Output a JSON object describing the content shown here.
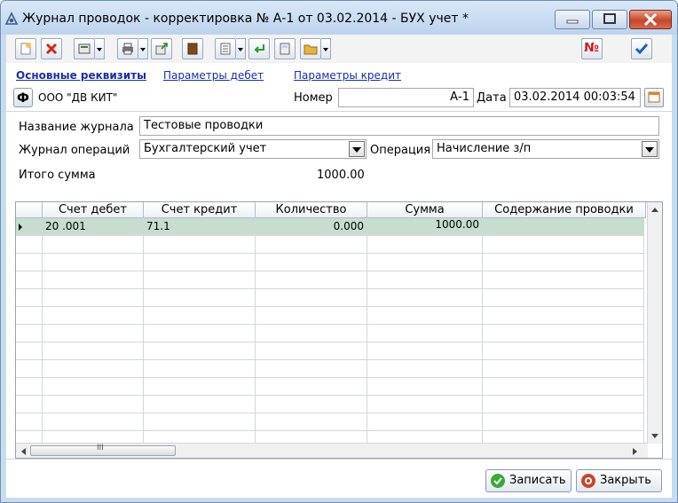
{
  "window": {
    "title": "Журнал проводок - корректировка № А-1 от 03.02.2014 - БУХ учет *"
  },
  "toolbar": {
    "number_icon_text": "№"
  },
  "tabs": [
    {
      "label": "Основные реквизиты",
      "active": true
    },
    {
      "label": "Параметры дебет",
      "active": false
    },
    {
      "label": "Параметры кредит",
      "active": false
    }
  ],
  "header": {
    "f_button": "Ф",
    "organization": "ООО \"ДВ КИТ\"",
    "number_label": "Номер",
    "number_value": "А-1",
    "date_label": "Дата",
    "date_value": "03.02.2014 00:03:54"
  },
  "form": {
    "journal_name_label": "Название журнала",
    "journal_name_value": "Тестовые проводки",
    "ops_journal_label": "Журнал операций",
    "ops_journal_value": "Бухгалтерский учет",
    "operation_label": "Операция",
    "operation_value": "Начисление з/п",
    "total_label": "Итого сумма",
    "total_value": "1000.00"
  },
  "grid": {
    "columns": [
      "Счет дебет",
      "Счет кредит",
      "Количество",
      "Сумма",
      "Содержание проводки"
    ],
    "rows": [
      [
        "20 .001",
        "71.1",
        "0.000",
        "1000.00",
        ""
      ]
    ],
    "hscroll_grip": "III"
  },
  "footer": {
    "save_label": "Записать",
    "close_label": "Закрыть"
  },
  "colors": {
    "selected_row": "#c6ddd0",
    "tab_link": "#1a2ea6",
    "close_button": "#c8462a"
  }
}
